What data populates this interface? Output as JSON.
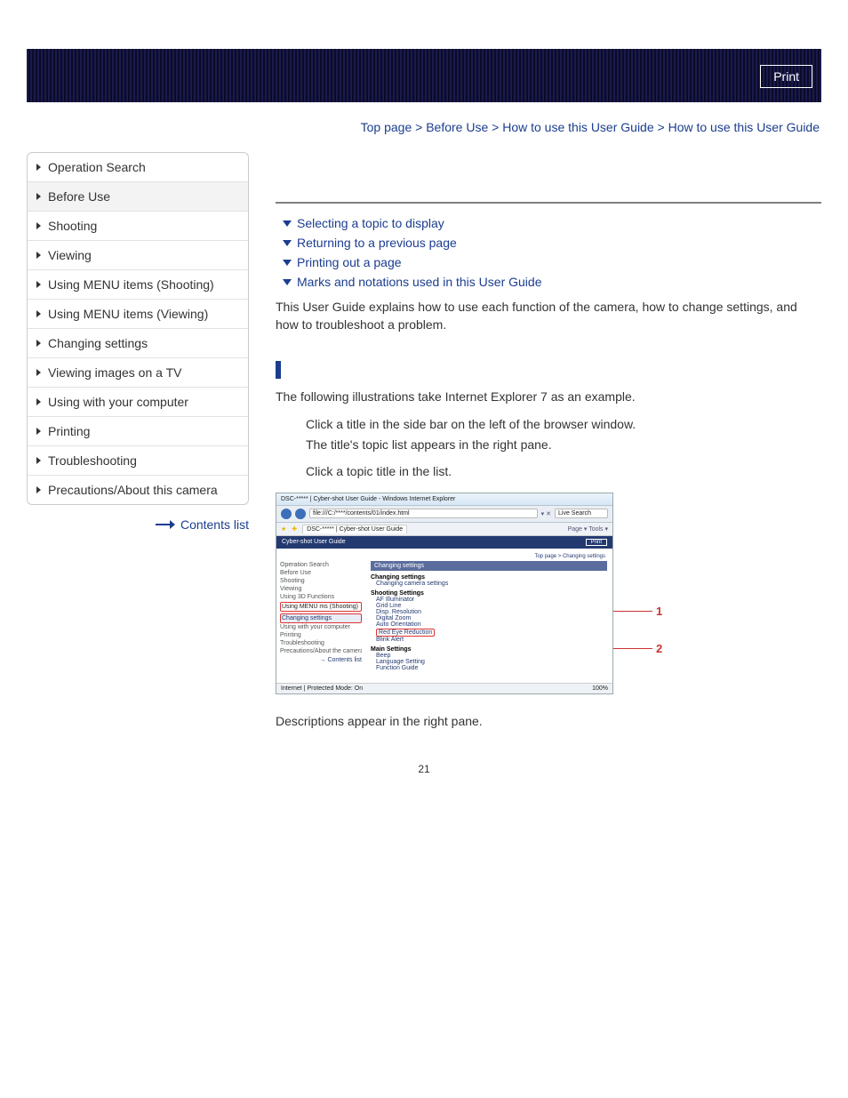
{
  "banner": {
    "print": "Print"
  },
  "breadcrumb": {
    "items": [
      "Top page",
      "Before Use",
      "How to use this User Guide"
    ],
    "current": "How to use this User Guide"
  },
  "sidebar": {
    "items": [
      {
        "label": "Operation Search"
      },
      {
        "label": "Before Use"
      },
      {
        "label": "Shooting"
      },
      {
        "label": "Viewing"
      },
      {
        "label": "Using MENU items (Shooting)"
      },
      {
        "label": "Using MENU items (Viewing)"
      },
      {
        "label": "Changing settings"
      },
      {
        "label": "Viewing images on a TV"
      },
      {
        "label": "Using with your computer"
      },
      {
        "label": "Printing"
      },
      {
        "label": "Troubleshooting"
      },
      {
        "label": "Precautions/About this camera"
      }
    ],
    "contents_list": "Contents list"
  },
  "anchors": {
    "a1": "Selecting a topic to display",
    "a2": "Returning to a previous page",
    "a3": "Printing out a page",
    "a4": "Marks and notations used in this User Guide"
  },
  "intro": "This User Guide explains how to use each function of the camera, how to change settings, and how to troubleshoot a problem.",
  "section": {
    "lead": "The following illustrations take Internet Explorer 7 as an example.",
    "step1a": "Click a title in the side bar on the left of the browser window.",
    "step1b": "The title's topic list appears in the right pane.",
    "step2": "Click a topic title in the list."
  },
  "illust": {
    "titlebar": "DSC-*****  | Cyber-shot User Guide - Windows Internet Explorer",
    "address": "file:///C:/****/contents/01/index.html",
    "search": "Live Search",
    "tab": "DSC-*****  | Cyber-shot User Guide",
    "toolbar": "Page  ▾   Tools ▾",
    "header": "Cyber-shot User Guide",
    "print_small": "Print",
    "bc": "Top page > Changing settings",
    "side": {
      "s0": "Operation Search",
      "s1": "Before Use",
      "s2": "Shooting",
      "s3": "Viewing",
      "s4": "Using 3D Functions",
      "s5a": "Using MENU",
      "s5b": "ms (Shooting)",
      "s6": "Changing settings",
      "s7": "Using with your computer",
      "s8": "Printing",
      "s9": "Troubleshooting",
      "s10": "Precautions/About the camera",
      "clist": "→ Contents list"
    },
    "main": {
      "block": "Changing settings",
      "h1": "Changing settings",
      "h1s": "Changing camera settings",
      "group": "Shooting Settings",
      "g1": "AF Illuminator",
      "g2": "Grid Line",
      "g3": "Disp. Resolution",
      "g4": "Digital Zoom",
      "g5": "Auto Orientation",
      "g6": "Red Eye Reduction",
      "g7": "Blink Alert",
      "mgroup": "Main Settings",
      "m1": "Beep",
      "m2": "Language Setting",
      "m3": "Function Guide"
    },
    "status_left": "Internet | Protected Mode: On",
    "status_right": "100%",
    "callout1": "1",
    "callout2": "2"
  },
  "desc": "Descriptions appear in the right pane.",
  "page_number": "21"
}
